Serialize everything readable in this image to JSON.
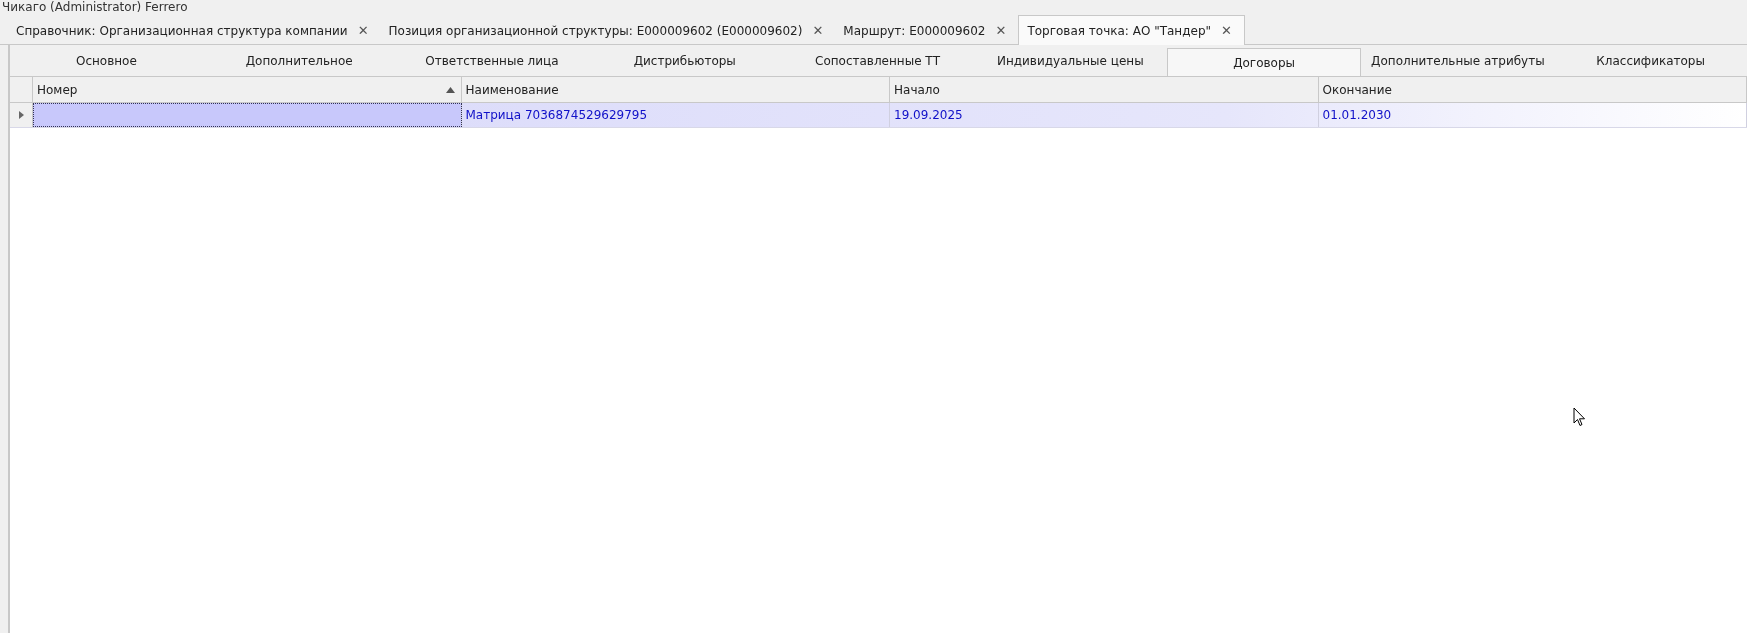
{
  "window": {
    "title": "Чикаго (Administrator) Ferrero"
  },
  "document_tabs": [
    {
      "label": "Справочник: Организационная структура компании",
      "selected": false
    },
    {
      "label": "Позиция организационной структуры:  E000009602 (E000009602)",
      "selected": false
    },
    {
      "label": "Маршрут:  E000009602",
      "selected": false
    },
    {
      "label": "Торговая точка:  АО \"Тандер\"",
      "selected": true
    }
  ],
  "close_glyph": "✕",
  "tabs": [
    {
      "label": "Основное",
      "selected": false
    },
    {
      "label": "Дополнительное",
      "selected": false
    },
    {
      "label": "Ответственные лица",
      "selected": false
    },
    {
      "label": "Дистрибьюторы",
      "selected": false
    },
    {
      "label": "Сопоставленные ТТ",
      "selected": false
    },
    {
      "label": "Индивидуальные цены",
      "selected": false
    },
    {
      "label": "Договоры",
      "selected": true
    },
    {
      "label": "Дополнительные атрибуты",
      "selected": false
    },
    {
      "label": "Классификаторы",
      "selected": false
    }
  ],
  "table": {
    "columns": [
      {
        "label": "Номер",
        "sorted": true
      },
      {
        "label": "Наименование",
        "sorted": false
      },
      {
        "label": "Начало",
        "sorted": false
      },
      {
        "label": "Окончание",
        "sorted": false
      }
    ],
    "rows": [
      {
        "selected": true,
        "cells": [
          "",
          "Матрица 7036874529629795",
          "19.09.2025",
          "01.01.2030"
        ]
      }
    ]
  }
}
